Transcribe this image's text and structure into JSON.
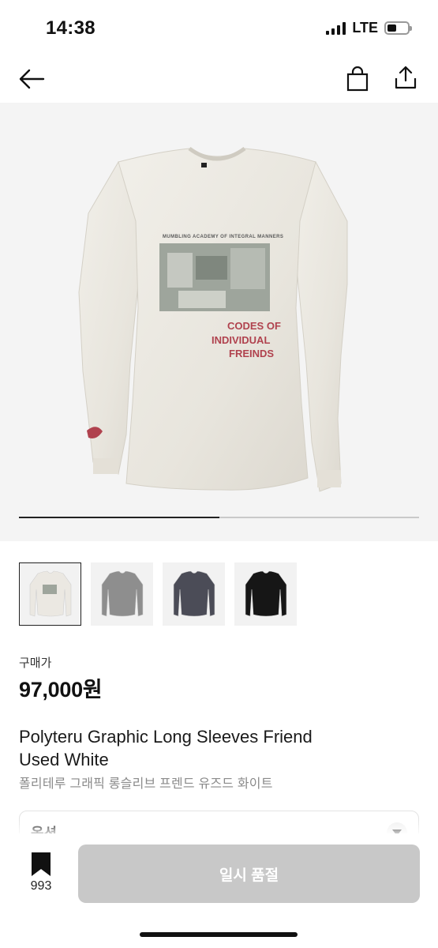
{
  "status_bar": {
    "time": "14:38",
    "network": "LTE"
  },
  "nav": {
    "back_icon": "arrow-left-icon",
    "bag_icon": "shopping-bag-icon",
    "share_icon": "share-icon"
  },
  "gallery": {
    "print_top_text": "MUMBLING ACADEMY OF INTEGRAL MANNERS",
    "print_red_text": [
      "CODES OF",
      "INDIVIDUAL",
      "FREINDS"
    ],
    "progress_fraction": 0.5
  },
  "thumbnails": [
    {
      "name": "white",
      "color": "#ebe8e2",
      "selected": true
    },
    {
      "name": "grey",
      "color": "#8e8e8e",
      "selected": false
    },
    {
      "name": "charcoal",
      "color": "#4b4c57",
      "selected": false
    },
    {
      "name": "black",
      "color": "#161616",
      "selected": false
    }
  ],
  "product": {
    "price_label": "구매가",
    "price": "97,000원",
    "title_en_line1": "Polyteru Graphic Long Sleeves Friend",
    "title_en_line2": "Used White",
    "title_ko": "폴리테루 그래픽 롱슬리브 프렌드 유즈드 화이트"
  },
  "options": {
    "label": "옵션"
  },
  "bottom_bar": {
    "bookmark_count": "993",
    "soldout_label": "일시 품절"
  },
  "colors": {
    "accent": "#111111",
    "soldout_bg": "#c8c8c8",
    "print_red": "#b0424e"
  }
}
